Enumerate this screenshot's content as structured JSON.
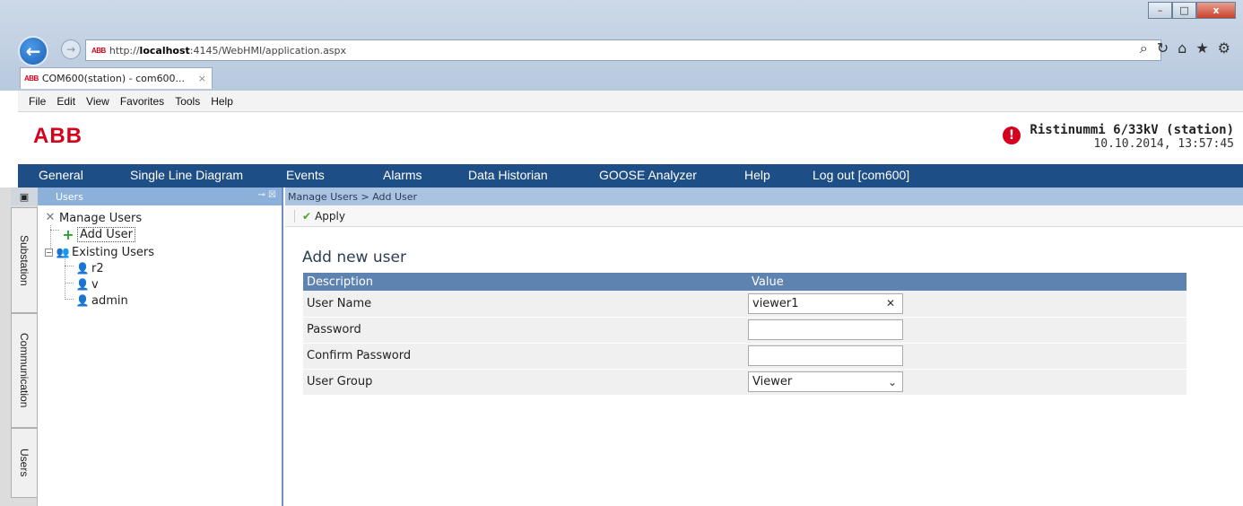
{
  "browser": {
    "url_prefix": "http://",
    "url_host": "localhost",
    "url_rest": ":4145/WebHMI/application.aspx",
    "tab_title": "COM600(station) - com600...",
    "tab_close": "×",
    "favicon_text": "ABB",
    "window_controls": [
      "–",
      "□",
      "x"
    ],
    "toolbar_icons": [
      "search-icon",
      "refresh-icon",
      "home-icon",
      "star-icon",
      "gear-icon"
    ],
    "menu": [
      "File",
      "Edit",
      "View",
      "Favorites",
      "Tools",
      "Help"
    ]
  },
  "header": {
    "logo": "ABB",
    "station_name": "Ristinummi 6/33kV (station)",
    "station_time": "10.10.2014, 13:57:45",
    "alert_symbol": "!"
  },
  "nav": {
    "items": [
      "General",
      "Single Line Diagram",
      "Events",
      "Alarms",
      "Data Historian",
      "GOOSE Analyzer",
      "Help",
      "Log out [com600]"
    ]
  },
  "side_tabs": [
    "Substation",
    "Communication",
    "Users"
  ],
  "panel": {
    "title": "Users",
    "tree": {
      "root": "Manage Users",
      "add_user": "Add User",
      "existing": "Existing Users",
      "users": [
        "r2",
        "v",
        "admin"
      ]
    }
  },
  "content": {
    "breadcrumb": "Manage Users > Add User",
    "apply_label": "Apply",
    "form_title": "Add new user",
    "table_headers": [
      "Description",
      "Value"
    ],
    "fields": {
      "user_name_label": "User Name",
      "user_name_value": "viewer1",
      "password_label": "Password",
      "confirm_password_label": "Confirm Password",
      "user_group_label": "User Group",
      "user_group_value": "Viewer"
    }
  },
  "colors": {
    "nav_bg": "#1d4e86",
    "brand_red": "#d6001c",
    "table_header": "#5f83b1"
  }
}
